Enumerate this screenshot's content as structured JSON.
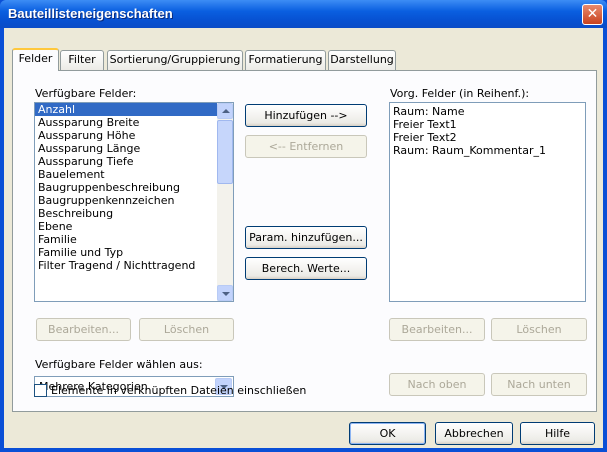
{
  "window": {
    "title": "Bauteillisteneigenschaften",
    "close_glyph": "✕"
  },
  "tabs": [
    "Felder",
    "Filter",
    "Sortierung/Gruppierung",
    "Formatierung",
    "Darstellung"
  ],
  "available": {
    "label": "Verfügbare Felder:",
    "items": [
      "Anzahl",
      "Aussparung Breite",
      "Aussparung Höhe",
      "Aussparung Länge",
      "Aussparung Tiefe",
      "Bauelement",
      "Baugruppenbeschreibung",
      "Baugruppenkennzeichen",
      "Beschreibung",
      "Ebene",
      "Familie",
      "Familie und Typ",
      "Filter Tragend / Nichttragend"
    ],
    "selected_index": 0
  },
  "middle_buttons": {
    "add": "Hinzufügen -->",
    "remove": "<-- Entfernen",
    "add_param": "Param. hinzufügen...",
    "calc_values": "Berech. Werte..."
  },
  "scheduled": {
    "label": "Vorg. Felder (in Reihenf.):",
    "items": [
      "Raum: Name",
      "Freier Text1",
      "Freier Text2",
      "Raum: Raum_Kommentar_1"
    ]
  },
  "left_edit": "Bearbeiten...",
  "left_delete": "Löschen",
  "right_edit": "Bearbeiten...",
  "right_delete": "Löschen",
  "select_from": {
    "label": "Verfügbare Felder wählen aus:",
    "value": "Mehrere Kategorien"
  },
  "move_up": "Nach oben",
  "move_down": "Nach unten",
  "include_linked": "Elemente in verknüpften Dateien einschließen",
  "footer": {
    "ok": "OK",
    "cancel": "Abbrechen",
    "help": "Hilfe"
  },
  "colors": {
    "title_bar": "#0a5fe0",
    "selection": "#316ac5",
    "dialog_bg": "#ece9d8",
    "active_tab_accent": "#ffc83c"
  }
}
